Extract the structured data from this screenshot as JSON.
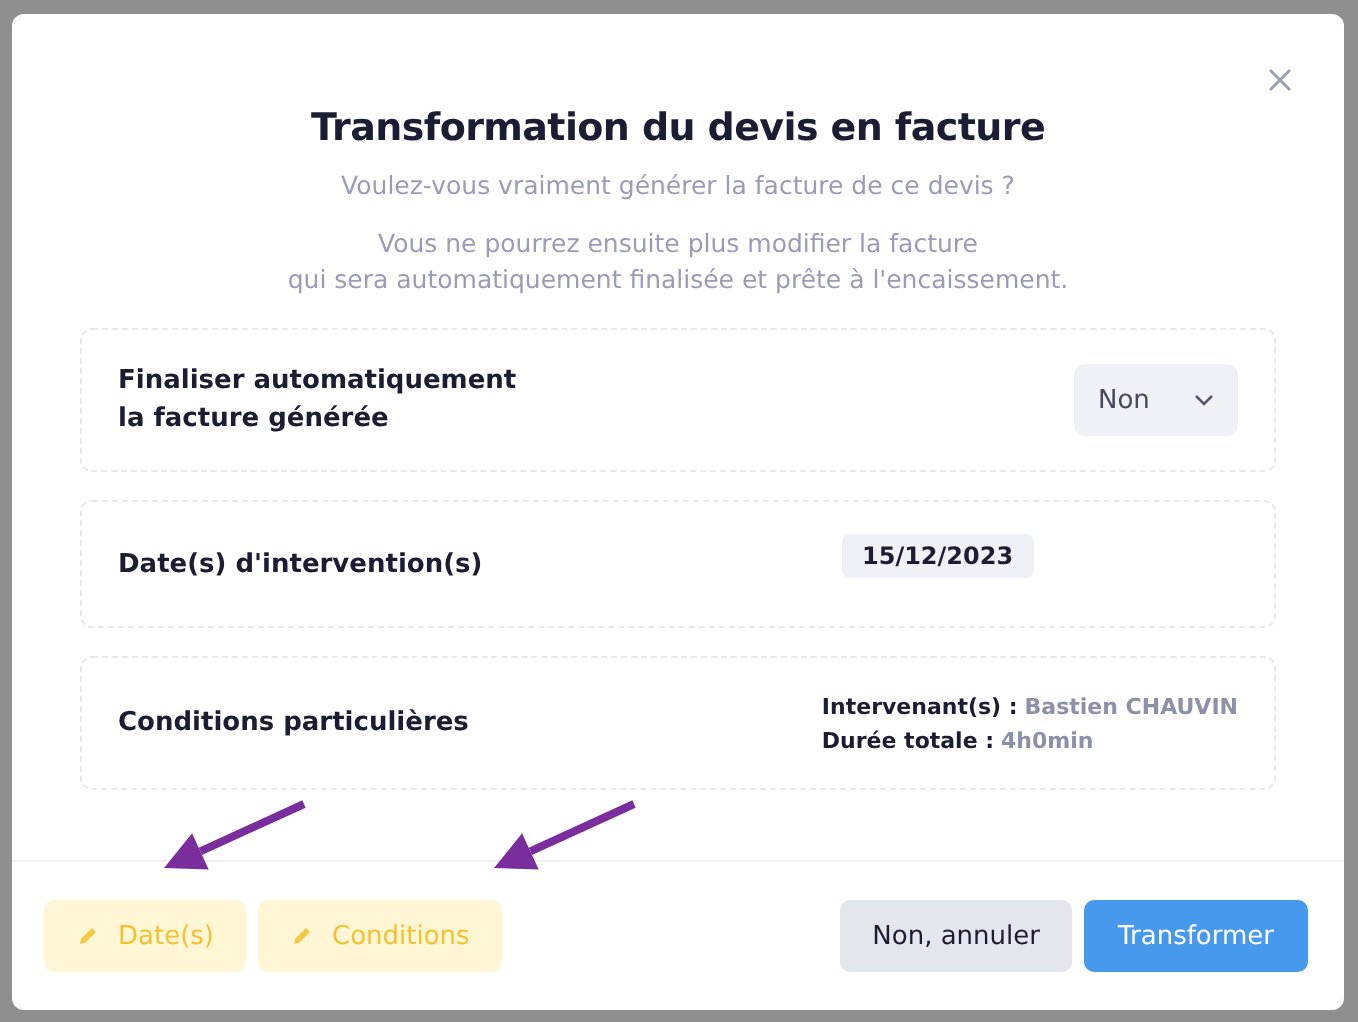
{
  "dialog": {
    "title": "Transformation du devis en facture",
    "subtitle": "Voulez-vous vraiment générer la facture de ce devis ?",
    "message": [
      "Vous ne pourrez ensuite plus modifier la facture",
      "qui sera automatiquement finalisée et prête à l'encaissement."
    ],
    "fields": [
      {
        "kind": "select",
        "label": [
          "Finaliser automatiquement",
          "la facture générée"
        ],
        "value": "Non"
      },
      {
        "kind": "date",
        "label": [
          "Date(s) d'intervention(s)"
        ],
        "value": "15/12/2023"
      },
      {
        "kind": "info",
        "label": [
          "Conditions particulières"
        ],
        "details": [
          {
            "label": "Intervenant(s) :",
            "value": "Bastien CHAUVIN"
          },
          {
            "label": "Durée totale :",
            "value": "4h0min"
          }
        ]
      }
    ],
    "edit_buttons": [
      "Date(s)",
      "Conditions"
    ],
    "cancel_button": "Non, annuler",
    "confirm_button": "Transformer"
  }
}
